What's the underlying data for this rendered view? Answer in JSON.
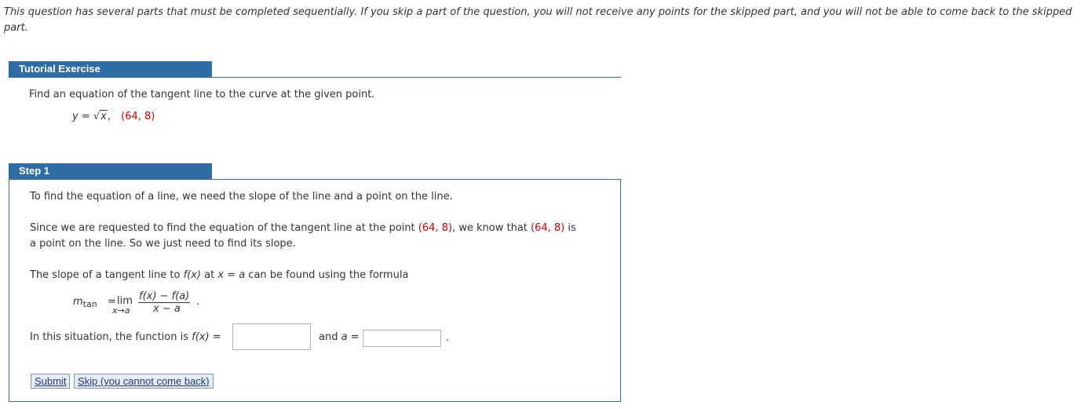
{
  "notice": "This question has several parts that must be completed sequentially. If you skip a part of the question, you will not receive any points for the skipped part, and you will not be able to come back to the skipped part.",
  "tutorial": {
    "header": "Tutorial Exercise",
    "prompt": "Find an equation of the tangent line to the curve at the given point.",
    "equation_lhs": "y",
    "equation_eq": " = ",
    "sqrt_symbol": "√",
    "radicand": "x",
    "comma": ",",
    "point": "(64, 8)"
  },
  "step": {
    "header": "Step 1",
    "para1": "To find the equation of a line, we need the slope of the line and a point on the line.",
    "para2_a": "Since we are requested to find the equation of the tangent line at the point ",
    "para2_point1": "(64, 8)",
    "para2_b": ", we know that ",
    "para2_point2": "(64, 8)",
    "para2_c": " is",
    "para2_line2": "a point on the line. So we just need to find its slope.",
    "para3_a": "The slope of a tangent line to ",
    "para3_fx": "f(x)",
    "para3_b": " at ",
    "para3_xa": "x = a",
    "para3_c": " can be found using the formula",
    "formula": {
      "m": "m",
      "m_sub": "tan",
      "eq": "=",
      "lim": "lim",
      "lim_sub": "x→a",
      "numerator": "f(x) − f(a)",
      "denominator": "x − a",
      "period": "."
    },
    "para4_a": "In this situation, the function is ",
    "para4_fx": "f(x)",
    "para4_eq": " =",
    "and_a_label_a": "and ",
    "and_a_label_var": "a",
    "and_a_label_eq": " =",
    "trailing_period": ".",
    "fx_input_value": "",
    "a_input_value": ""
  },
  "buttons": {
    "submit": "Submit",
    "skip": "Skip (you cannot come back)"
  },
  "colors": {
    "header_blue": "#2e6da6",
    "highlight_red": "#d40000"
  }
}
